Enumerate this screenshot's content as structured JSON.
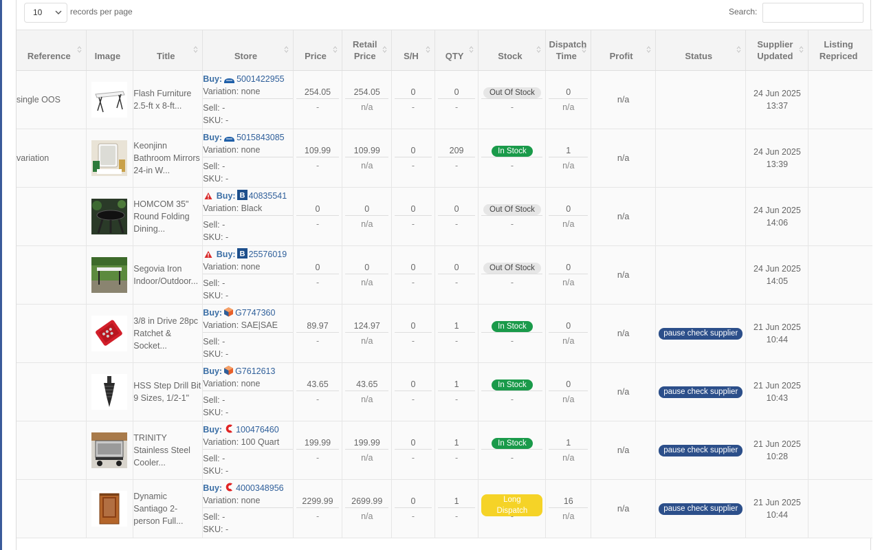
{
  "controls": {
    "page_length_value": "10",
    "page_length_label": "records per page",
    "search_label": "Search:",
    "search_value": ""
  },
  "columns": [
    "Reference",
    "Image",
    "Title",
    "Store",
    "Price",
    "Retail Price",
    "S/H",
    "QTY",
    "Stock",
    "Dispatch Time",
    "Profit",
    "Status",
    "Supplier Updated",
    "Listing Repriced"
  ],
  "common": {
    "sell_label": "Sell: -",
    "sku_label": "SKU: -",
    "buy_label": "Buy:",
    "dash": "-",
    "na": "n/a"
  },
  "rows": [
    {
      "reference": "single OOS",
      "image_icon": "folding-table-image",
      "title": "Flash Furniture 2.5-ft x 8-ft...",
      "warning": false,
      "store_logo": "walmart-icon",
      "store_id": "5001422955",
      "variation": "Variation: none",
      "price": "254.05",
      "retail": "254.05",
      "sh": "0",
      "qty": "0",
      "stock": "Out Of Stock",
      "stock_type": "out",
      "dispatch": "0",
      "profit": "n/a",
      "status": "",
      "updated_date": "24 Jun 2025",
      "updated_time": "13:37"
    },
    {
      "reference": "variation",
      "image_icon": "bathroom-mirror-image",
      "title": "Keonjinn Bathroom Mirrors 24-in W...",
      "warning": false,
      "store_logo": "walmart-icon",
      "store_id": "5015843085",
      "variation": "Variation: none",
      "price": "109.99",
      "retail": "109.99",
      "sh": "0",
      "qty": "209",
      "stock": "In Stock",
      "stock_type": "in",
      "dispatch": "1",
      "profit": "n/a",
      "status": "",
      "updated_date": "24 Jun 2025",
      "updated_time": "13:39"
    },
    {
      "reference": "",
      "image_icon": "round-table-image",
      "title": "HOMCOM 35\" Round Folding Dining...",
      "warning": true,
      "store_logo": "b-store-icon",
      "store_id": "40835541",
      "variation": "Variation: Black",
      "price": "0",
      "retail": "0",
      "sh": "0",
      "qty": "0",
      "stock": "Out Of Stock",
      "stock_type": "out",
      "dispatch": "0",
      "profit": "n/a",
      "status": "",
      "updated_date": "24 Jun 2025",
      "updated_time": "14:06"
    },
    {
      "reference": "",
      "image_icon": "outdoor-table-image",
      "title": "Segovia Iron Indoor/Outdoor...",
      "warning": true,
      "store_logo": "b-store-icon",
      "store_id": "25576019",
      "variation": "Variation: none",
      "price": "0",
      "retail": "0",
      "sh": "0",
      "qty": "0",
      "stock": "Out Of Stock",
      "stock_type": "out",
      "dispatch": "0",
      "profit": "n/a",
      "status": "",
      "updated_date": "24 Jun 2025",
      "updated_time": "14:05"
    },
    {
      "reference": "",
      "image_icon": "socket-set-image",
      "title": "3/8 in Drive 28pc Ratchet & Socket...",
      "warning": false,
      "store_logo": "cube-store-icon",
      "store_id": "G7747360",
      "variation": "Variation: SAE|SAE",
      "price": "89.97",
      "retail": "124.97",
      "sh": "0",
      "qty": "1",
      "stock": "In Stock",
      "stock_type": "in",
      "dispatch": "0",
      "profit": "n/a",
      "status": "pause check supplier",
      "updated_date": "21 Jun 2025",
      "updated_time": "10:44"
    },
    {
      "reference": "",
      "image_icon": "step-drill-image",
      "title": "HSS Step Drill Bit 9 Sizes, 1/2-1\"",
      "warning": false,
      "store_logo": "cube-store-icon",
      "store_id": "G7612613",
      "variation": "Variation: none",
      "price": "43.65",
      "retail": "43.65",
      "sh": "0",
      "qty": "1",
      "stock": "In Stock",
      "stock_type": "in",
      "dispatch": "0",
      "profit": "n/a",
      "status": "pause check supplier",
      "updated_date": "21 Jun 2025",
      "updated_time": "10:43"
    },
    {
      "reference": "",
      "image_icon": "cooler-cart-image",
      "title": "TRINITY Stainless Steel Cooler...",
      "warning": false,
      "store_logo": "c-store-icon",
      "store_id": "100476460",
      "variation": "Variation: 100 Quart",
      "price": "199.99",
      "retail": "199.99",
      "sh": "0",
      "qty": "1",
      "stock": "In Stock",
      "stock_type": "in",
      "dispatch": "1",
      "profit": "n/a",
      "status": "pause check supplier",
      "updated_date": "21 Jun 2025",
      "updated_time": "10:28"
    },
    {
      "reference": "",
      "image_icon": "sauna-image",
      "title": "Dynamic Santiago 2-person Full...",
      "warning": false,
      "store_logo": "c-store-icon",
      "store_id": "4000348956",
      "variation": "Variation: none",
      "price": "2299.99",
      "retail": "2699.99",
      "sh": "0",
      "qty": "1",
      "stock": "Long Dispatch",
      "stock_type": "long",
      "dispatch": "16",
      "profit": "n/a",
      "status": "pause check supplier",
      "updated_date": "21 Jun 2025",
      "updated_time": "10:44"
    }
  ],
  "colors": {
    "in_stock": "#1a9a4a",
    "out_stock": "#e6e6e6",
    "long_dispatch": "#f5d327",
    "pause": "#2c4f8a",
    "link": "#2f5f9a",
    "accent_bar": "#3a5a9a"
  }
}
